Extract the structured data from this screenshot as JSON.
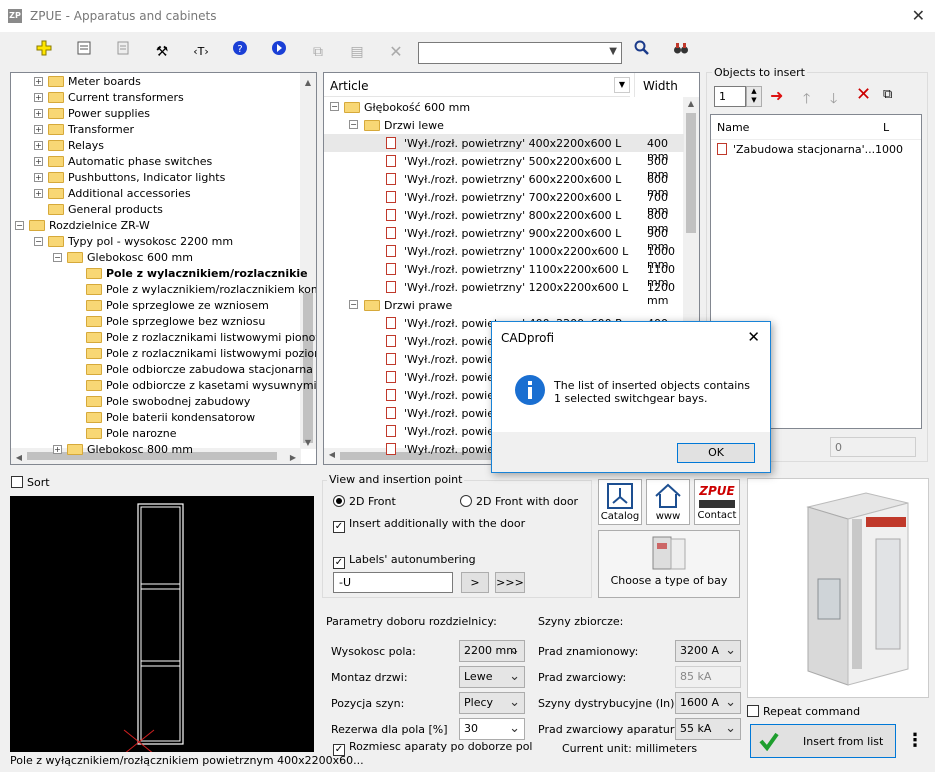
{
  "window": {
    "title": "ZPUE - Apparatus and cabinets",
    "app_icon": "ZP"
  },
  "toolbar": {
    "search_value": ""
  },
  "tree": {
    "items": [
      {
        "label": "Meter boards",
        "indent": 1,
        "pm": "+"
      },
      {
        "label": "Current transformers",
        "indent": 1,
        "pm": "+"
      },
      {
        "label": "Power supplies",
        "indent": 1,
        "pm": "+"
      },
      {
        "label": "Transformer",
        "indent": 1,
        "pm": "+"
      },
      {
        "label": "Relays",
        "indent": 1,
        "pm": "+"
      },
      {
        "label": "Automatic phase switches",
        "indent": 1,
        "pm": "+"
      },
      {
        "label": "Pushbuttons, Indicator lights",
        "indent": 1,
        "pm": "+"
      },
      {
        "label": "Additional accessories",
        "indent": 1,
        "pm": "+"
      },
      {
        "label": "General products",
        "indent": 1,
        "pm": ""
      },
      {
        "label": "Rozdzielnice ZR-W",
        "indent": 0,
        "pm": "-"
      },
      {
        "label": "Typy pol - wysokosc 2200 mm",
        "indent": 1,
        "pm": "-"
      },
      {
        "label": "Glebokosc 600 mm",
        "indent": 2,
        "pm": "-"
      },
      {
        "label": "Pole z wylacznikiem/rozlacznikie",
        "indent": 3,
        "pm": "",
        "bold": true
      },
      {
        "label": "Pole z wylacznikiem/rozlacznikiem komp",
        "indent": 3,
        "pm": ""
      },
      {
        "label": "Pole sprzeglowe ze wzniosem",
        "indent": 3,
        "pm": ""
      },
      {
        "label": "Pole sprzeglowe bez wzniosu",
        "indent": 3,
        "pm": ""
      },
      {
        "label": "Pole z rozlacznikami listwowymi pionowy",
        "indent": 3,
        "pm": ""
      },
      {
        "label": "Pole z rozlacznikami listwowymi poziomy",
        "indent": 3,
        "pm": ""
      },
      {
        "label": "Pole odbiorcze zabudowa stacjonarna",
        "indent": 3,
        "pm": ""
      },
      {
        "label": "Pole odbiorcze z kasetami wysuwnymi",
        "indent": 3,
        "pm": ""
      },
      {
        "label": "Pole swobodnej zabudowy",
        "indent": 3,
        "pm": ""
      },
      {
        "label": "Pole baterii kondensatorow",
        "indent": 3,
        "pm": ""
      },
      {
        "label": "Pole narozne",
        "indent": 3,
        "pm": ""
      },
      {
        "label": "Glebokosc 800 mm",
        "indent": 2,
        "pm": "+"
      }
    ]
  },
  "articles": {
    "col_article": "Article",
    "col_width": "Width",
    "group": "Głębokość 600 mm",
    "sub_left": "Drzwi lewe",
    "sub_right": "Drzwi prawe",
    "left_items": [
      {
        "name": "'Wył./rozł. powietrzny'  400x2200x600 L",
        "width": "400 mm"
      },
      {
        "name": "'Wył./rozł. powietrzny'  500x2200x600 L",
        "width": "500 mm"
      },
      {
        "name": "'Wył./rozł. powietrzny'  600x2200x600 L",
        "width": "600 mm"
      },
      {
        "name": "'Wył./rozł. powietrzny'  700x2200x600 L",
        "width": "700 mm"
      },
      {
        "name": "'Wył./rozł. powietrzny'  800x2200x600 L",
        "width": "800 mm"
      },
      {
        "name": "'Wył./rozł. powietrzny'  900x2200x600 L",
        "width": "900 mm"
      },
      {
        "name": "'Wył./rozł. powietrzny' 1000x2200x600 L",
        "width": "1000 mm"
      },
      {
        "name": "'Wył./rozł. powietrzny' 1100x2200x600 L",
        "width": "1100 mm"
      },
      {
        "name": "'Wył./rozł. powietrzny' 1200x2200x600 L",
        "width": "1200 mm"
      }
    ],
    "right_items": [
      {
        "name": "'Wył./rozł. powietrzny'  400x2200x600 P",
        "width": "400 mm"
      },
      {
        "name": "'Wył./rozł. powie",
        "width": ""
      },
      {
        "name": "'Wył./rozł. powie",
        "width": ""
      },
      {
        "name": "'Wył./rozł. powie",
        "width": ""
      },
      {
        "name": "'Wył./rozł. powie",
        "width": ""
      },
      {
        "name": "'Wył./rozł. powie",
        "width": ""
      },
      {
        "name": "'Wył./rozł. powie",
        "width": ""
      },
      {
        "name": "'Wył./rozł. powie",
        "width": ""
      }
    ]
  },
  "objects": {
    "title": "Objects to insert",
    "qty": "1",
    "col_name": "Name",
    "col_l": "L",
    "row_name": "'Zabudowa stacjonarna'...",
    "row_l": "1000",
    "total": "0"
  },
  "sort_label": "Sort",
  "preview_caption": "Pole z wyłącznikiem/rozłącznikiem powietrznym 400x2200x60...",
  "view": {
    "title": "View and insertion point",
    "front": "2D Front",
    "front_door": "2D Front with door",
    "insert_door": "Insert additionally with the door",
    "autonum": "Labels' autonumbering",
    "prefix": "-U",
    "btn1": ">",
    "btn2": ">>>"
  },
  "links": {
    "catalog": "Catalog",
    "www": "www",
    "contact": "Contact",
    "zpue_logo": "ZPUE",
    "choose": "Choose a type of bay"
  },
  "params": {
    "title": "Parametry doboru rozdzielnicy:",
    "rows": [
      {
        "label": "Wysokosc pola:",
        "value": "2200 mm"
      },
      {
        "label": "Montaz drzwi:",
        "value": "Lewe"
      },
      {
        "label": "Pozycja szyn:",
        "value": "Plecy"
      },
      {
        "label": "Rezerwa dla pola [%]",
        "value": "30"
      }
    ],
    "place": "Rozmiesc aparaty po doborze pol"
  },
  "szyny": {
    "title": "Szyny zbiorcze:",
    "rows": [
      {
        "label": "Prad znamionowy:",
        "value": "3200 A"
      },
      {
        "label": "Prad zwarciowy:",
        "value": "85 kA"
      },
      {
        "label": "Szyny dystrybucyjne (In):",
        "value": "1600 A"
      },
      {
        "label": "Prad zwarciowy aparatury:",
        "value": "55 kA"
      }
    ],
    "unit": "Current unit: millimeters"
  },
  "repeat": "Repeat command",
  "insert_btn": "Insert from list",
  "dialog": {
    "title": "CADprofi",
    "line1": "The list of inserted objects contains",
    "line2": "1 selected switchgear bays.",
    "ok": "OK"
  }
}
